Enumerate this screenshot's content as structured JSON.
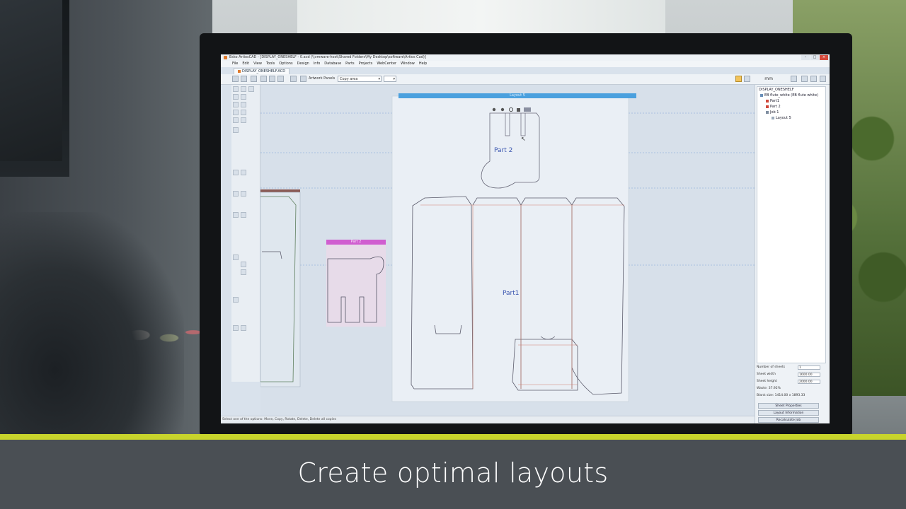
{
  "window": {
    "title": "Esko ArtiosCAD - [DISPLAY_ONESHELF - 0.acd (\\\\vmware-host\\Shared Folders\\My Desktop\\software\\Artios Cad)]",
    "minimize": "–",
    "maximize": "□",
    "close": "×"
  },
  "menu": [
    "File",
    "Edit",
    "View",
    "Tools",
    "Options",
    "Design",
    "Info",
    "Database",
    "Parts",
    "Projects",
    "WebCenter",
    "Window",
    "Help"
  ],
  "document_tab": "DISPLAY_ONESHELF.ACD",
  "toolbar": {
    "artwork_panels": "Artwork Panels",
    "copy_area": "Copy area",
    "units": "mm"
  },
  "canvas": {
    "sheet_header": "Layout 5",
    "part2_label": "Part 2",
    "part1_label": "Part1",
    "part2_preview_header": "Part 2"
  },
  "tree": {
    "root": "DISPLAY_ONESHELF",
    "board": "EB flute_white (EB flute white)",
    "part1": "Part1",
    "part2": "Part 2",
    "job": "Job 1",
    "layout": "Layout 5"
  },
  "properties": {
    "number_of_sheets_label": "Number of sheets",
    "number_of_sheets": "1",
    "sheet_width_label": "Sheet width",
    "sheet_width": "1600.00",
    "sheet_height_label": "Sheet height",
    "sheet_height": "2000.00",
    "waste": "Waste: 37.92%",
    "blank_size": "Blank size: 1414.00 x 1893.33",
    "sheet_properties": "Sheet Properties",
    "layout_information": "Layout Information",
    "recalculate_job": "Recalculate Job"
  },
  "status": "Select one of the options: Move, Copy, Rotate, Delete, Delete all copies",
  "caption": "Create optimal layouts",
  "colors": {
    "caption_stripe": "#c8d42c",
    "caption_bg": "#4a4f54",
    "sheet_header": "#4aa0de",
    "part2_preview_header": "#d05ed0"
  }
}
